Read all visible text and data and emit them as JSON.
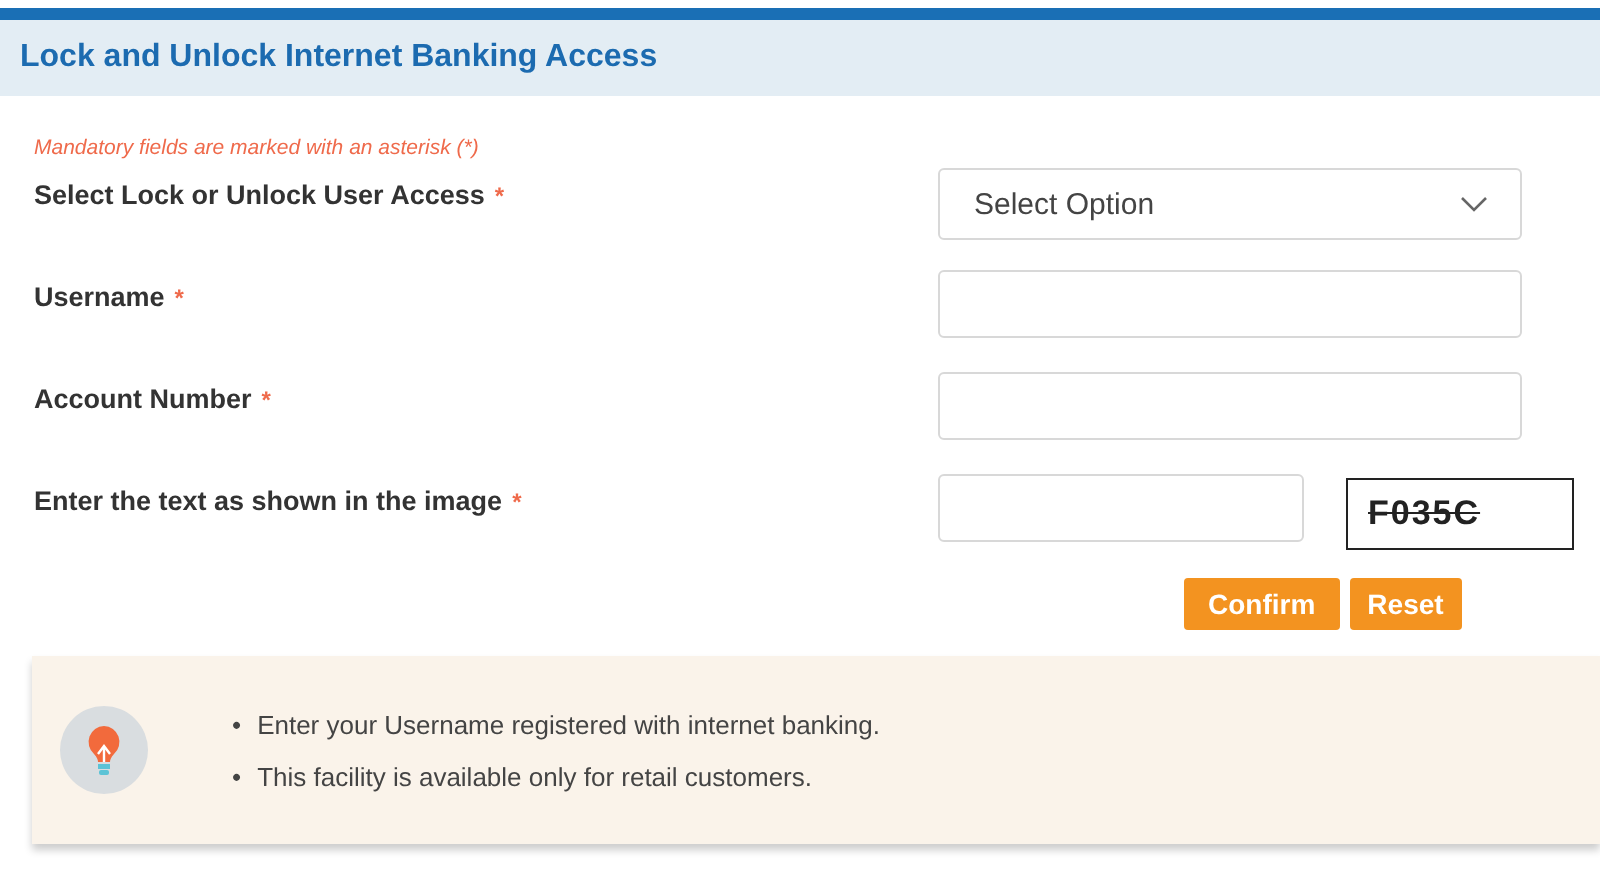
{
  "header": {
    "title": "Lock and Unlock Internet Banking Access"
  },
  "note": "Mandatory fields are marked with an asterisk (*)",
  "fields": [
    {
      "kind": "select",
      "label": "Select Lock or Unlock User Access",
      "required_mark": "*",
      "value": "Select Option"
    },
    {
      "kind": "text",
      "label": "Username",
      "required_mark": "*"
    },
    {
      "kind": "text",
      "label": "Account Number",
      "required_mark": "*"
    },
    {
      "kind": "captcha",
      "label": "Enter the text as shown in the image",
      "required_mark": "*",
      "captcha": "F035C"
    }
  ],
  "buttons": [
    "Confirm",
    "Reset"
  ],
  "info": [
    {
      "bullet": "•",
      "text": "Enter your Username registered with internet banking."
    },
    {
      "bullet": "•",
      "text": "This facility is available only for retail customers."
    }
  ]
}
